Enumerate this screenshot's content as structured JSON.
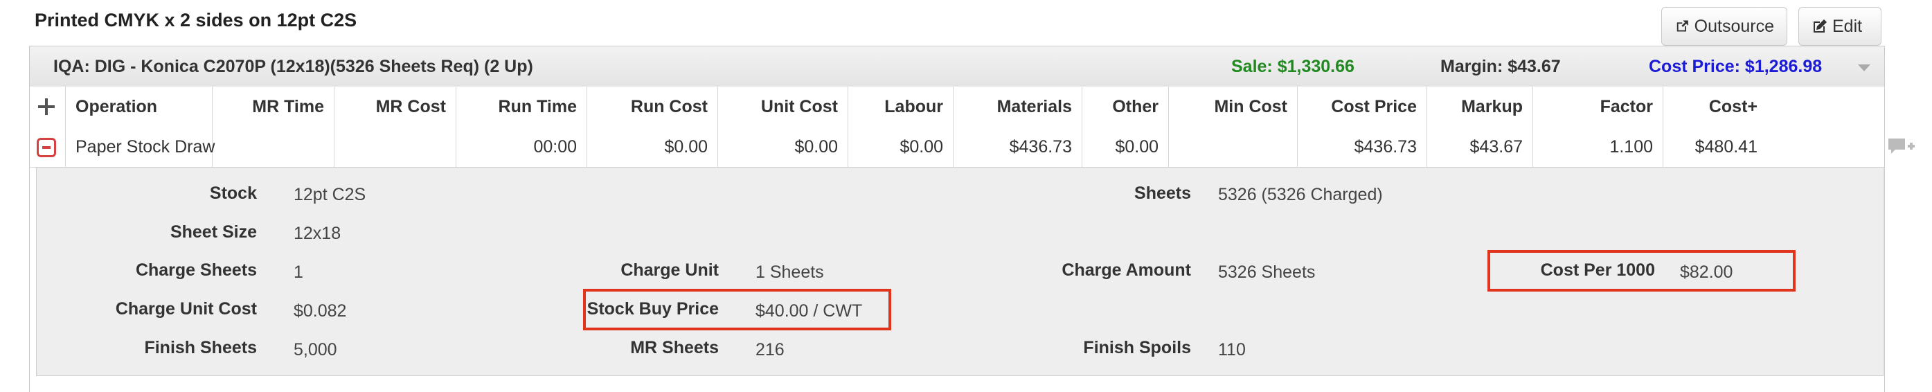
{
  "title": "Printed CMYK x 2 sides on 12pt C2S",
  "buttons": {
    "outsource": "Outsource",
    "edit": "Edit"
  },
  "header": {
    "iqa": "IQA: DIG - Konica C2070P (12x18)(5326 Sheets Req) (2 Up)",
    "sale": "Sale: $1,330.66",
    "margin": "Margin: $43.67",
    "cost_price": "Cost Price: $1,286.98"
  },
  "columns": [
    "Operation",
    "MR Time",
    "MR Cost",
    "Run Time",
    "Run Cost",
    "Unit Cost",
    "Labour",
    "Materials",
    "Other",
    "Min Cost",
    "Cost Price",
    "Markup",
    "Factor",
    "Cost+"
  ],
  "row": {
    "operation": "Paper Stock Draw",
    "mr_time": "",
    "mr_cost": "",
    "run_time": "00:00",
    "run_cost": "$0.00",
    "unit_cost": "$0.00",
    "labour": "$0.00",
    "materials": "$436.73",
    "other": "$0.00",
    "min_cost": "",
    "cost_price": "$436.73",
    "markup": "$43.67",
    "factor": "1.100",
    "cost_plus": "$480.41"
  },
  "details": {
    "stock": {
      "label": "Stock",
      "value": "12pt C2S"
    },
    "sheets": {
      "label": "Sheets",
      "value": "5326 (5326 Charged)"
    },
    "sheet_size": {
      "label": "Sheet Size",
      "value": "12x18"
    },
    "charge_sheets": {
      "label": "Charge Sheets",
      "value": "1"
    },
    "charge_unit": {
      "label": "Charge Unit",
      "value": "1 Sheets"
    },
    "charge_amount": {
      "label": "Charge Amount",
      "value": "5326 Sheets"
    },
    "cost_per_1000": {
      "label": "Cost Per 1000",
      "value": "$82.00"
    },
    "charge_unit_cost": {
      "label": "Charge Unit Cost",
      "value": "$0.082"
    },
    "stock_buy_price": {
      "label": "Stock Buy Price",
      "value": "$40.00 / CWT"
    },
    "finish_sheets": {
      "label": "Finish Sheets",
      "value": "5,000"
    },
    "mr_sheets": {
      "label": "MR Sheets",
      "value": "216"
    },
    "finish_spoils": {
      "label": "Finish Spoils",
      "value": "110"
    }
  },
  "colors": {
    "sale": "#208a20",
    "cost_price": "#1b1bd6",
    "highlight": "#e1341e",
    "remove": "#d64141"
  }
}
